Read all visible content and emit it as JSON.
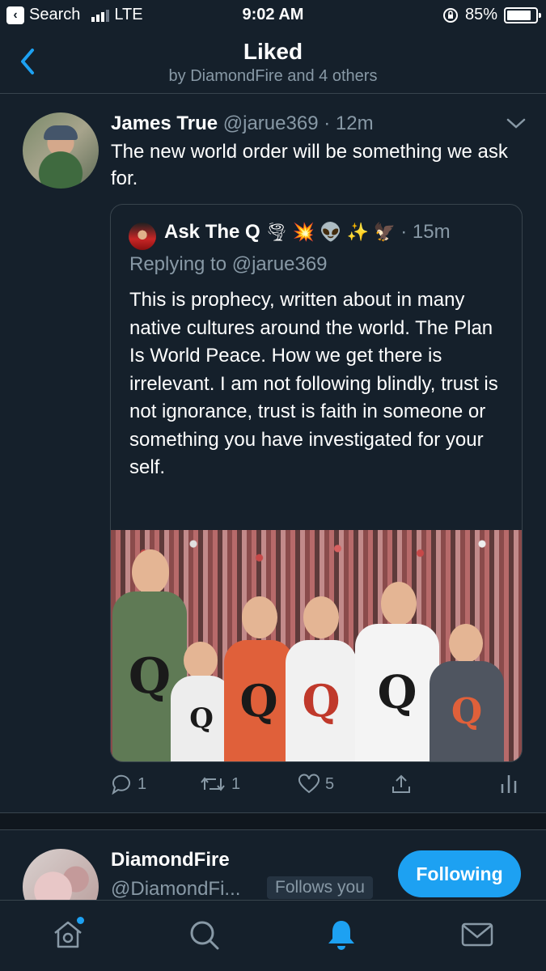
{
  "status_bar": {
    "back_app": "Search",
    "carrier": "LTE",
    "time": "9:02 AM",
    "battery": "85%",
    "battery_level": 0.85
  },
  "header": {
    "title": "Liked",
    "subtitle": "by DiamondFire and 4 others"
  },
  "tweet": {
    "name": "James True",
    "handle": "@jarue369",
    "time": "· 12m",
    "text": "The new world order will be something we ask for.",
    "quote": {
      "name": "Ask The Q",
      "emojis": [
        "🌪",
        "💥",
        "👽",
        "✨",
        "🦅"
      ],
      "time": "· 15m",
      "replying_to": "Replying to @jarue369",
      "text": "This is prophecy, written about in many native cultures around the world.  The Plan Is World Peace. How we get there is irrelevant. I am not following blindly, trust is not ignorance, trust is faith in someone or something you have investigated for your self."
    },
    "actions": {
      "replies": "1",
      "retweets": "1",
      "likes": "5"
    }
  },
  "user_card": {
    "name": "DiamondFire",
    "handle": "@DiamondFi...",
    "follows_you": "Follows you",
    "button": "Following"
  },
  "tabs": [
    "home",
    "search",
    "notifications",
    "messages"
  ],
  "colors": {
    "background": "#15202b",
    "accent": "#1da1f2",
    "muted": "#8899a6",
    "border": "#38444d"
  }
}
